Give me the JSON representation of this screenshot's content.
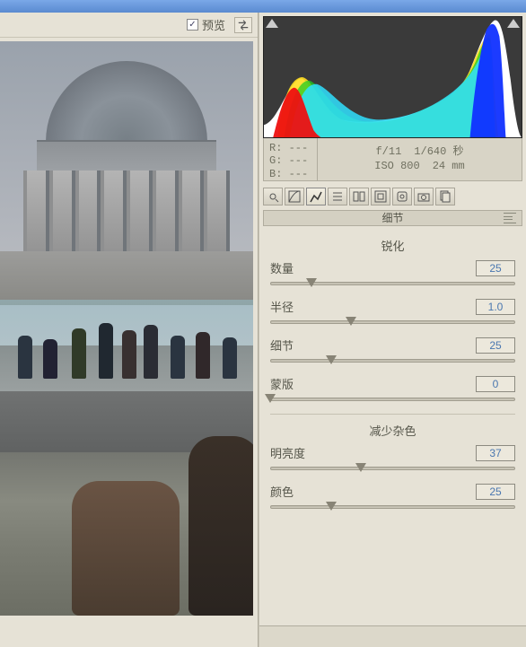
{
  "preview": {
    "label": "预览",
    "checked": true
  },
  "histogram": {
    "shadow_clipping": true,
    "highlight_clipping": true
  },
  "color_readout": {
    "r": "R: ---",
    "g": "G: ---",
    "b": "B: ---"
  },
  "exposure_info": {
    "aperture": "f/11",
    "shutter": "1/640 秒",
    "iso": "ISO 800",
    "focal": "24 mm"
  },
  "tabs": [
    "basic",
    "tone-curve",
    "detail",
    "hsl",
    "split-tone",
    "lens",
    "effects",
    "camera",
    "presets"
  ],
  "active_tab": 2,
  "panel_title": "细节",
  "sections": {
    "sharpen": {
      "title": "锐化",
      "sliders": [
        {
          "key": "amount",
          "label": "数量",
          "value": "25",
          "pos": 0.17
        },
        {
          "key": "radius",
          "label": "半径",
          "value": "1.0",
          "pos": 0.33
        },
        {
          "key": "detail",
          "label": "细节",
          "value": "25",
          "pos": 0.25
        },
        {
          "key": "masking",
          "label": "蒙版",
          "value": "0",
          "pos": 0.0
        }
      ]
    },
    "noise": {
      "title": "减少杂色",
      "sliders": [
        {
          "key": "luminance",
          "label": "明亮度",
          "value": "37",
          "pos": 0.37
        },
        {
          "key": "color",
          "label": "颜色",
          "value": "25",
          "pos": 0.25
        }
      ]
    }
  }
}
